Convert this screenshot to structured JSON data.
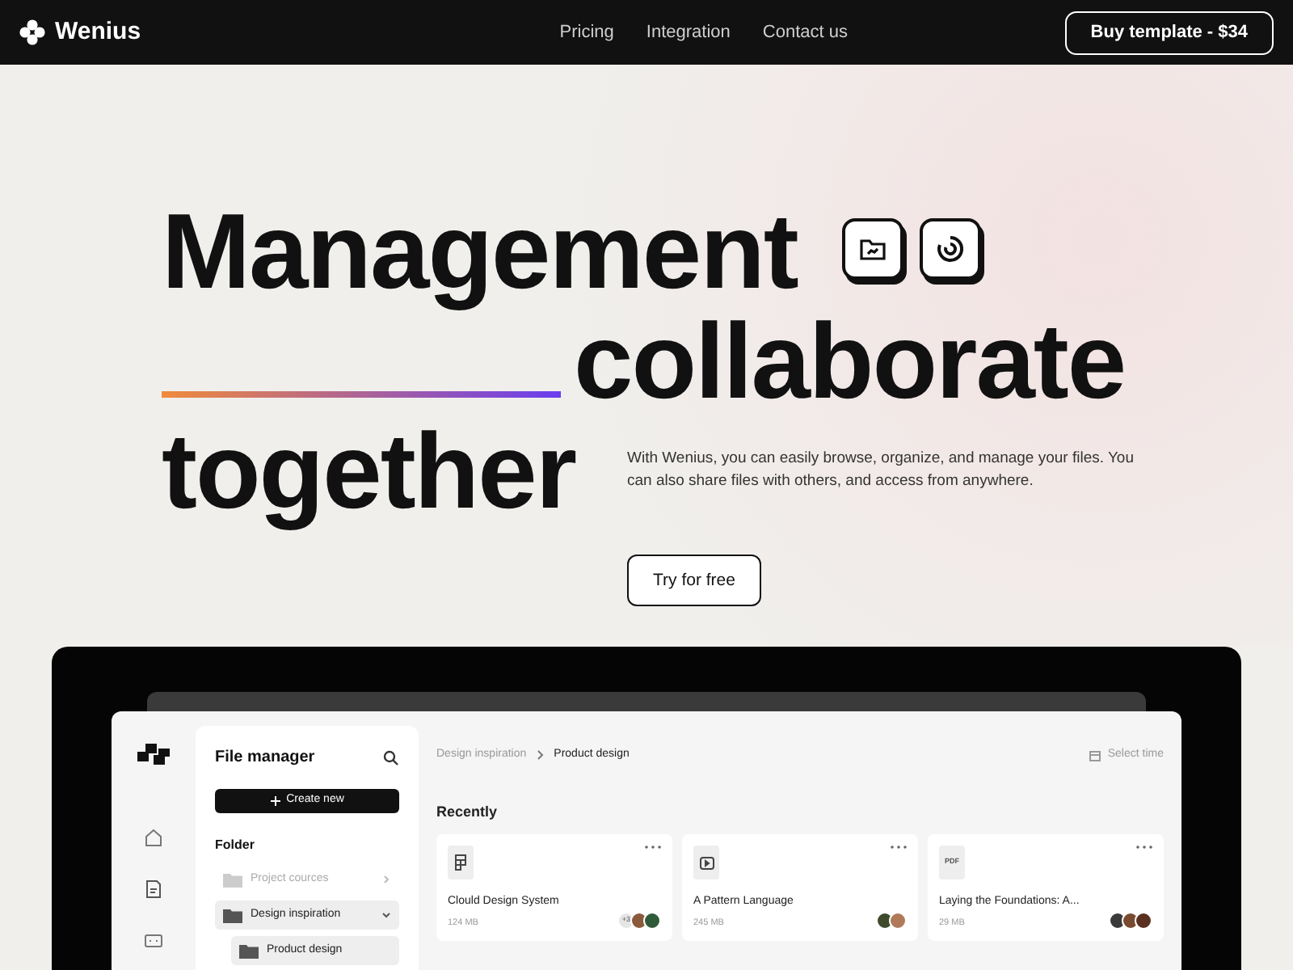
{
  "nav": {
    "brand": "Wenius",
    "links": [
      "Pricing",
      "Integration",
      "Contact us"
    ],
    "cta": "Buy template - $34"
  },
  "hero": {
    "line_1": "Management",
    "line_2": "collaborate",
    "line_3": "together",
    "description": "With Wenius, you can easily browse, organize, and manage your files. You can also share files with others, and access from anywhere.",
    "button": "Try for free"
  },
  "app": {
    "sidebar": {
      "title": "File manager",
      "create_button": "Create new",
      "folder_heading": "Folder",
      "folders": [
        {
          "label": "Project cources",
          "selected": false,
          "expanded": false
        },
        {
          "label": "Design inspiration",
          "selected": true,
          "expanded": true,
          "children": [
            {
              "label": "Product design",
              "selected": true
            }
          ]
        }
      ]
    },
    "breadcrumb": [
      "Design inspiration",
      "Product design"
    ],
    "select_time": "Select time",
    "section_title": "Recently",
    "files": [
      {
        "kind": "figma",
        "name": "Clould Design System",
        "size": "124 MB",
        "more_people": "+3",
        "avatars": [
          {
            "color": "#8a5a3c"
          },
          {
            "color": "#2f5b3a"
          }
        ]
      },
      {
        "kind": "video",
        "name": "A Pattern Language",
        "size": "245 MB",
        "avatars": [
          {
            "color": "#3d4a2c"
          },
          {
            "color": "#b07a5a"
          }
        ]
      },
      {
        "kind": "pdf",
        "badge": "PDF",
        "name": "Laying the Foundations: A...",
        "size": "29 MB",
        "avatars": [
          {
            "color": "#3a3a3a"
          },
          {
            "color": "#7a4a30"
          },
          {
            "color": "#5a3020"
          }
        ]
      }
    ]
  }
}
